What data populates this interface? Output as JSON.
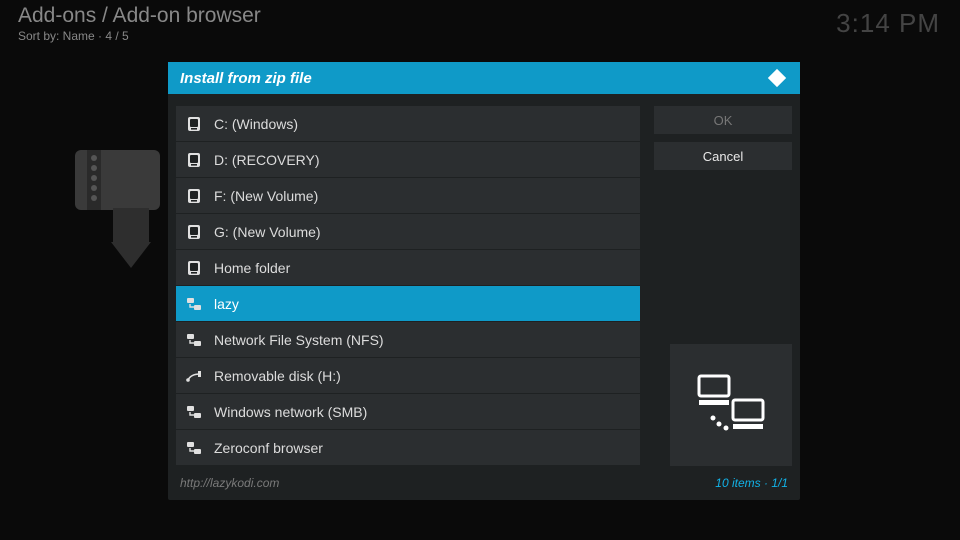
{
  "header": {
    "breadcrumb": "Add-ons / Add-on browser",
    "sortline": "Sort by: Name  · 4 / 5",
    "clock": "3:14 PM"
  },
  "dialog": {
    "title": "Install from zip file",
    "items": [
      {
        "icon": "drive",
        "label": "C: (Windows)",
        "selected": false
      },
      {
        "icon": "drive",
        "label": "D: (RECOVERY)",
        "selected": false
      },
      {
        "icon": "drive",
        "label": "F: (New Volume)",
        "selected": false
      },
      {
        "icon": "drive",
        "label": "G: (New Volume)",
        "selected": false
      },
      {
        "icon": "drive",
        "label": "Home folder",
        "selected": false
      },
      {
        "icon": "network",
        "label": "lazy",
        "selected": true
      },
      {
        "icon": "network",
        "label": "Network File System (NFS)",
        "selected": false
      },
      {
        "icon": "usb",
        "label": "Removable disk (H:)",
        "selected": false
      },
      {
        "icon": "network",
        "label": "Windows network (SMB)",
        "selected": false
      },
      {
        "icon": "network",
        "label": "Zeroconf browser",
        "selected": false
      }
    ],
    "ok_label": "OK",
    "cancel_label": "Cancel",
    "footer_path": "http://lazykodi.com",
    "footer_count": "10 items · 1/1"
  }
}
